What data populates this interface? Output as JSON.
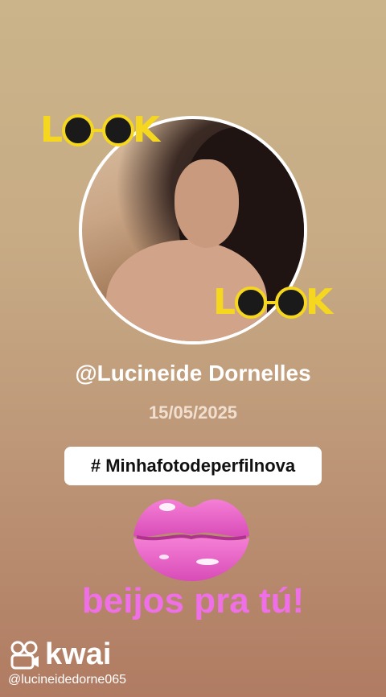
{
  "profile": {
    "username": "@Lucineide Dornelles",
    "date": "15/05/2025"
  },
  "stickers": {
    "look_top": "LOOK",
    "look_bottom": "LOOK"
  },
  "hashtag": "# Minhafotodeperfilnova",
  "message": "beijos pra tú!",
  "watermark": {
    "brand": "kwai",
    "handle": "@lucineidedorne065"
  },
  "colors": {
    "sticker_yellow": "#f5d71f",
    "message_pink": "#ee6fe6"
  },
  "icons": [
    "kwai-logo-icon",
    "lips-icon",
    "sunglasses-icon"
  ]
}
